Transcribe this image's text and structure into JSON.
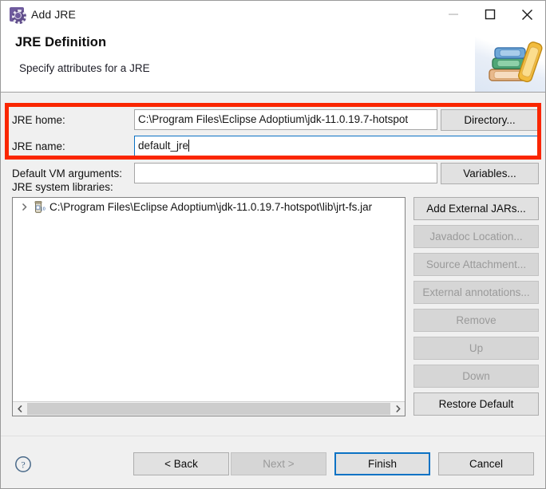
{
  "window": {
    "title": "Add JRE",
    "icon": "jre-app-icon",
    "controls": {
      "minimize": "minimize-icon",
      "maximize": "maximize-icon",
      "close": "close-icon"
    }
  },
  "header": {
    "title": "JRE Definition",
    "subtitle": "Specify attributes for a JRE",
    "art": "books-stack-image"
  },
  "form": {
    "jre_home": {
      "label": "JRE home:",
      "value": "C:\\Program Files\\Eclipse Adoptium\\jdk-11.0.19.7-hotspot",
      "button": "Directory..."
    },
    "jre_name": {
      "label": "JRE name:",
      "value": "default_jre",
      "focused": true
    },
    "vm_args": {
      "label": "Default VM arguments:",
      "value": "",
      "placeholder": "",
      "button": "Variables..."
    }
  },
  "libraries": {
    "caption": "JRE system libraries:",
    "items": [
      {
        "label": "C:\\Program Files\\Eclipse Adoptium\\jdk-11.0.19.7-hotspot\\lib\\jrt-fs.jar",
        "icon": "jar-file-icon",
        "expander": "chevron-right-icon"
      }
    ],
    "buttons": [
      {
        "label": "Add External JARs...",
        "enabled": true
      },
      {
        "label": "Javadoc Location...",
        "enabled": false
      },
      {
        "label": "Source Attachment...",
        "enabled": false
      },
      {
        "label": "External annotations...",
        "enabled": false
      },
      {
        "label": "Remove",
        "enabled": false
      },
      {
        "label": "Up",
        "enabled": false
      },
      {
        "label": "Down",
        "enabled": false
      },
      {
        "label": "Restore Default",
        "enabled": true
      }
    ],
    "scrollbar": {
      "left_arrow": "chevron-left-icon",
      "right_arrow": "chevron-right-icon"
    }
  },
  "footer": {
    "help": "help-icon",
    "back": {
      "label": "< Back",
      "enabled": true
    },
    "next": {
      "label": "Next >",
      "enabled": false
    },
    "finish": {
      "label": "Finish",
      "enabled": true,
      "default": true
    },
    "cancel": {
      "label": "Cancel",
      "enabled": true
    }
  },
  "colors": {
    "accent": "#0b72c4",
    "annotation": "#fa2600",
    "body_bg": "#f0f0f0",
    "field_bg": "#ffffff"
  }
}
